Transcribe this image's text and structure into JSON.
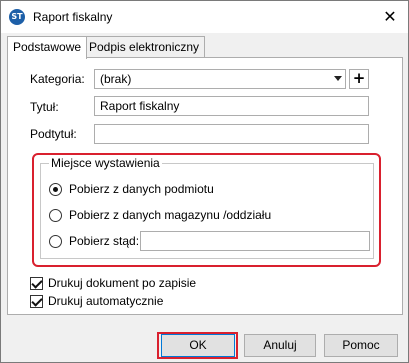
{
  "window": {
    "title": "Raport fiskalny",
    "app_icon_text": "ST"
  },
  "tabs": [
    {
      "label": "Podstawowe",
      "active": true
    },
    {
      "label": "Podpis elektroniczny",
      "active": false
    }
  ],
  "form": {
    "kategoria_label": "Kategoria:",
    "kategoria_value": "(brak)",
    "tytul_label": "Tytuł:",
    "tytul_value": "Raport fiskalny",
    "podtytul_label": "Podtytuł:",
    "podtytul_value": ""
  },
  "miejsce": {
    "title": "Miejsce wystawienia",
    "options": [
      {
        "label": "Pobierz z danych podmiotu",
        "checked": true
      },
      {
        "label": "Pobierz z danych magazynu /oddziału",
        "checked": false
      },
      {
        "label": "Pobierz stąd:",
        "checked": false
      }
    ],
    "custom_value": ""
  },
  "checkboxes": [
    {
      "label": "Drukuj dokument po zapisie",
      "checked": true
    },
    {
      "label": "Drukuj automatycznie",
      "checked": true
    }
  ],
  "buttons": {
    "ok": "OK",
    "cancel": "Anuluj",
    "help": "Pomoc"
  },
  "colors": {
    "highlight": "#d9202e",
    "accent": "#0078d7"
  }
}
